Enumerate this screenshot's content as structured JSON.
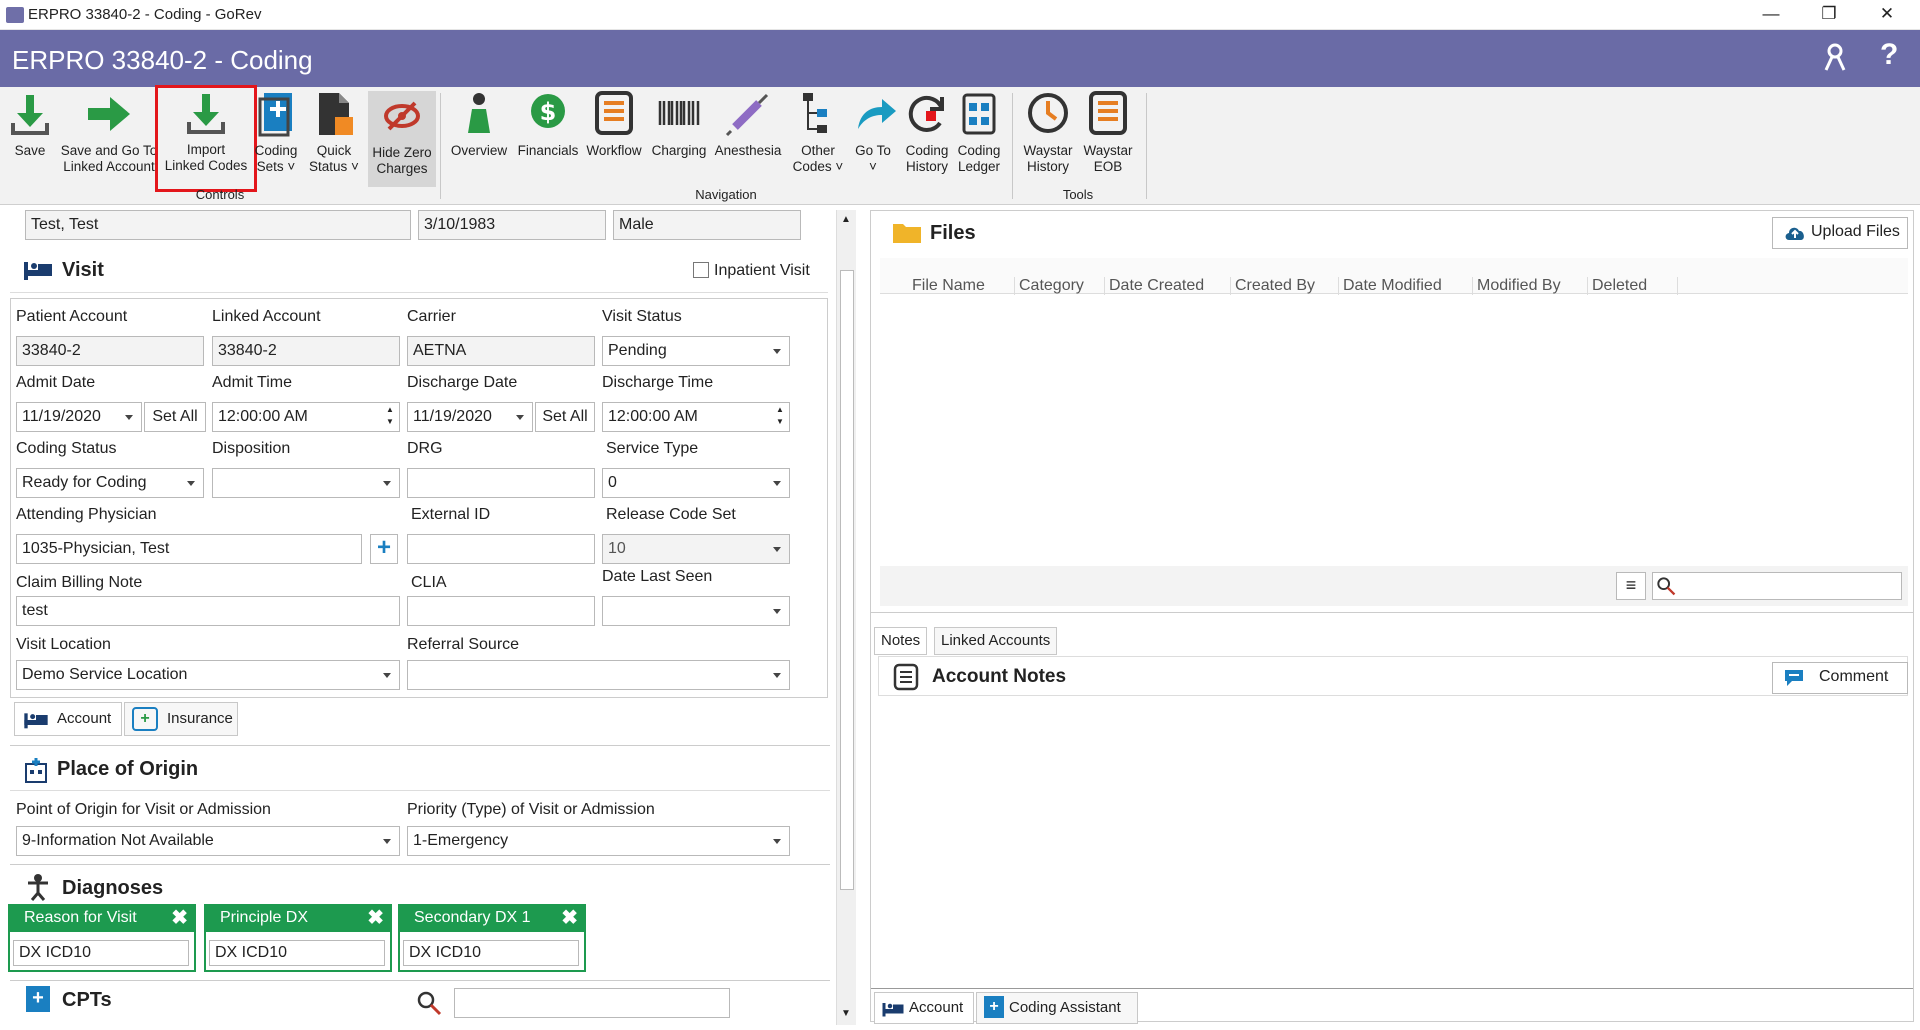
{
  "window": {
    "title": "ERPRO 33840-2 - Coding - GoRev",
    "minimize": "—",
    "restore": "❐",
    "close": "✕"
  },
  "header": {
    "title": "ERPRO 33840-2 - Coding",
    "help": "?"
  },
  "ribbon": {
    "controls": [
      {
        "l1": "Save",
        "l2": ""
      },
      {
        "l1": "Save and Go To",
        "l2": "Linked Account"
      },
      {
        "l1": "Import",
        "l2": "Linked Codes"
      },
      {
        "l1": "Coding",
        "l2": "Sets ˅"
      },
      {
        "l1": "Quick",
        "l2": "Status ˅"
      },
      {
        "l1": "Hide Zero",
        "l2": "Charges"
      }
    ],
    "navigation": [
      {
        "l1": "Overview",
        "l2": ""
      },
      {
        "l1": "Financials",
        "l2": ""
      },
      {
        "l1": "Workflow",
        "l2": ""
      },
      {
        "l1": "Charging",
        "l2": ""
      },
      {
        "l1": "Anesthesia",
        "l2": ""
      },
      {
        "l1": "Other",
        "l2": "Codes ˅"
      },
      {
        "l1": "Go To",
        "l2": "˅"
      },
      {
        "l1": "Coding",
        "l2": "History"
      },
      {
        "l1": "Coding",
        "l2": "Ledger"
      }
    ],
    "tools": [
      {
        "l1": "Waystar",
        "l2": "History"
      },
      {
        "l1": "Waystar",
        "l2": "EOB"
      }
    ],
    "groups": {
      "controls": "Controls",
      "navigation": "Navigation",
      "tools": "Tools"
    }
  },
  "patient": {
    "name": "Test, Test",
    "dob": "3/10/1983",
    "sex": "Male"
  },
  "visit": {
    "title": "Visit",
    "inpatient_label": "Inpatient Visit",
    "patient_account_label": "Patient Account",
    "patient_account": "33840-2",
    "linked_account_label": "Linked Account",
    "linked_account": "33840-2",
    "carrier_label": "Carrier",
    "carrier": "AETNA",
    "visit_status_label": "Visit Status",
    "visit_status": "Pending",
    "admit_date_label": "Admit Date",
    "admit_date": "11/19/2020",
    "set_all": "Set All",
    "admit_time_label": "Admit Time",
    "admit_time": "12:00:00 AM",
    "discharge_date_label": "Discharge Date",
    "discharge_date": "11/19/2020",
    "discharge_time_label": "Discharge Time",
    "discharge_time": "12:00:00 AM",
    "coding_status_label": "Coding Status",
    "coding_status": "Ready for Coding",
    "disposition_label": "Disposition",
    "disposition": "",
    "drg_label": "DRG",
    "drg": "",
    "service_type_label": "Service Type",
    "service_type": "0",
    "attending_label": "Attending Physician",
    "attending": "1035-Physician, Test",
    "external_id_label": "External ID",
    "external_id": "",
    "release_code_label": "Release Code Set",
    "release_code": "10",
    "claim_note_label": "Claim Billing Note",
    "claim_note": "test",
    "clia_label": "CLIA",
    "clia": "",
    "date_last_seen_label": "Date Last Seen",
    "date_last_seen": "",
    "location_label": "Visit Location",
    "location": "Demo Service Location",
    "referral_label": "Referral Source",
    "referral": "",
    "tab_account": "Account",
    "tab_insurance": "Insurance"
  },
  "origin": {
    "title": "Place of Origin",
    "point_label": "Point of Origin for Visit or Admission",
    "point": "9-Information Not Available",
    "priority_label": "Priority (Type) of Visit or Admission",
    "priority": "1-Emergency"
  },
  "diagnoses": {
    "title": "Diagnoses",
    "items": [
      {
        "label": "Reason for Visit",
        "value": "DX ICD10"
      },
      {
        "label": "Principle DX",
        "value": "DX ICD10"
      },
      {
        "label": "Secondary DX 1",
        "value": "DX ICD10"
      }
    ],
    "remove": "✖"
  },
  "cpts": {
    "title": "CPTs",
    "search": ""
  },
  "files": {
    "title": "Files",
    "upload": "Upload Files",
    "columns": [
      "File Name",
      "Category",
      "Date Created",
      "Created By",
      "Date Modified",
      "Modified By",
      "Deleted"
    ]
  },
  "notes": {
    "tab_notes": "Notes",
    "tab_linked": "Linked Accounts",
    "title": "Account Notes",
    "comment": "Comment"
  },
  "bottom_tabs": {
    "account": "Account",
    "assistant": "Coding Assistant"
  },
  "colors": {
    "header": "#6a6ba6",
    "dx": "#1d9a4f",
    "highlight": "#e3161b",
    "accent": "#1a7fc1"
  }
}
